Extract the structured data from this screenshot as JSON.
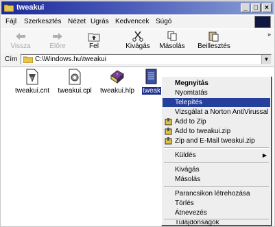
{
  "window": {
    "title": "tweakui"
  },
  "menubar": [
    "Fájl",
    "Szerkesztés",
    "Nézet",
    "Ugrás",
    "Kedvencek",
    "Súgó"
  ],
  "toolbar": {
    "back": "Vissza",
    "forward": "Előre",
    "up": "Fel",
    "cut": "Kivágás",
    "copy": "Másolás",
    "paste": "Beillesztés"
  },
  "address": {
    "label": "Cím",
    "path": "C:\\Windows.hu\\tweakui"
  },
  "files": [
    {
      "name": "tweakui.cnt",
      "icon": "help-contents-icon"
    },
    {
      "name": "tweakui.cpl",
      "icon": "control-panel-icon"
    },
    {
      "name": "tweakui.hlp",
      "icon": "help-book-icon"
    },
    {
      "name": "tweak",
      "icon": "inf-file-icon",
      "selected": true
    }
  ],
  "context_menu": {
    "items": [
      {
        "label": "Megnyitás",
        "bold": true
      },
      {
        "label": "Nyomtatás"
      },
      {
        "label": "Telepítés",
        "highlighted": true
      },
      {
        "label": "Vizsgálat a Norton AntiVirussal"
      },
      {
        "label": "Add to Zip",
        "icon": "winzip-icon"
      },
      {
        "label": "Add to tweakui.zip",
        "icon": "winzip-icon"
      },
      {
        "label": "Zip and E-Mail tweakui.zip",
        "icon": "winzip-icon"
      },
      {
        "label": "Küldés",
        "submenu": true
      },
      {
        "label": "Kivágás"
      },
      {
        "label": "Másolás"
      },
      {
        "label": "Parancsikon létrehozása"
      },
      {
        "label": "Törlés"
      },
      {
        "label": "Átnevezés"
      },
      {
        "label": "Tulajdonságok"
      }
    ]
  }
}
